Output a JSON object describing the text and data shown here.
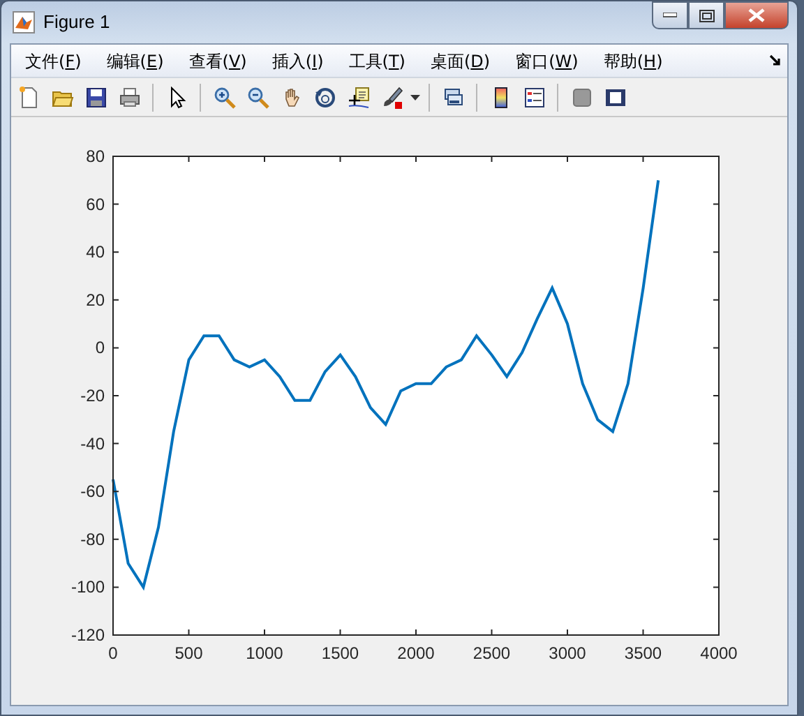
{
  "window": {
    "title": "Figure 1"
  },
  "menu": [
    {
      "label": "文件(F)"
    },
    {
      "label": "编辑(E)"
    },
    {
      "label": "查看(V)"
    },
    {
      "label": "插入(I)"
    },
    {
      "label": "工具(T)"
    },
    {
      "label": "桌面(D)"
    },
    {
      "label": "窗口(W)"
    },
    {
      "label": "帮助(H)"
    }
  ],
  "plot": {
    "chart_data": {
      "type": "line",
      "x": [
        0,
        100,
        200,
        300,
        400,
        500,
        600,
        700,
        800,
        900,
        1000,
        1100,
        1200,
        1300,
        1400,
        1500,
        1600,
        1700,
        1800,
        1900,
        2000,
        2100,
        2200,
        2300,
        2400,
        2500,
        2600,
        2700,
        2800,
        2900,
        3000,
        3100,
        3200,
        3300,
        3400,
        3500,
        3600
      ],
      "series": [
        {
          "color": "#0072bd",
          "values": [
            -55,
            -90,
            -100,
            -75,
            -35,
            -5,
            5,
            5,
            -5,
            -8,
            -5,
            -12,
            -22,
            -22,
            -10,
            -3,
            -12,
            -25,
            -32,
            -18,
            -15,
            -15,
            -8,
            -5,
            5,
            -3,
            -12,
            -2,
            12,
            25,
            10,
            -15,
            -30,
            -35,
            -15,
            25,
            70
          ]
        }
      ],
      "xlim": [
        0,
        4000
      ],
      "ylim": [
        -120,
        80
      ],
      "xticks": [
        0,
        500,
        1000,
        1500,
        2000,
        2500,
        3000,
        3500,
        4000
      ],
      "yticks": [
        -120,
        -100,
        -80,
        -60,
        -40,
        -20,
        0,
        20,
        40,
        60,
        80
      ]
    }
  }
}
